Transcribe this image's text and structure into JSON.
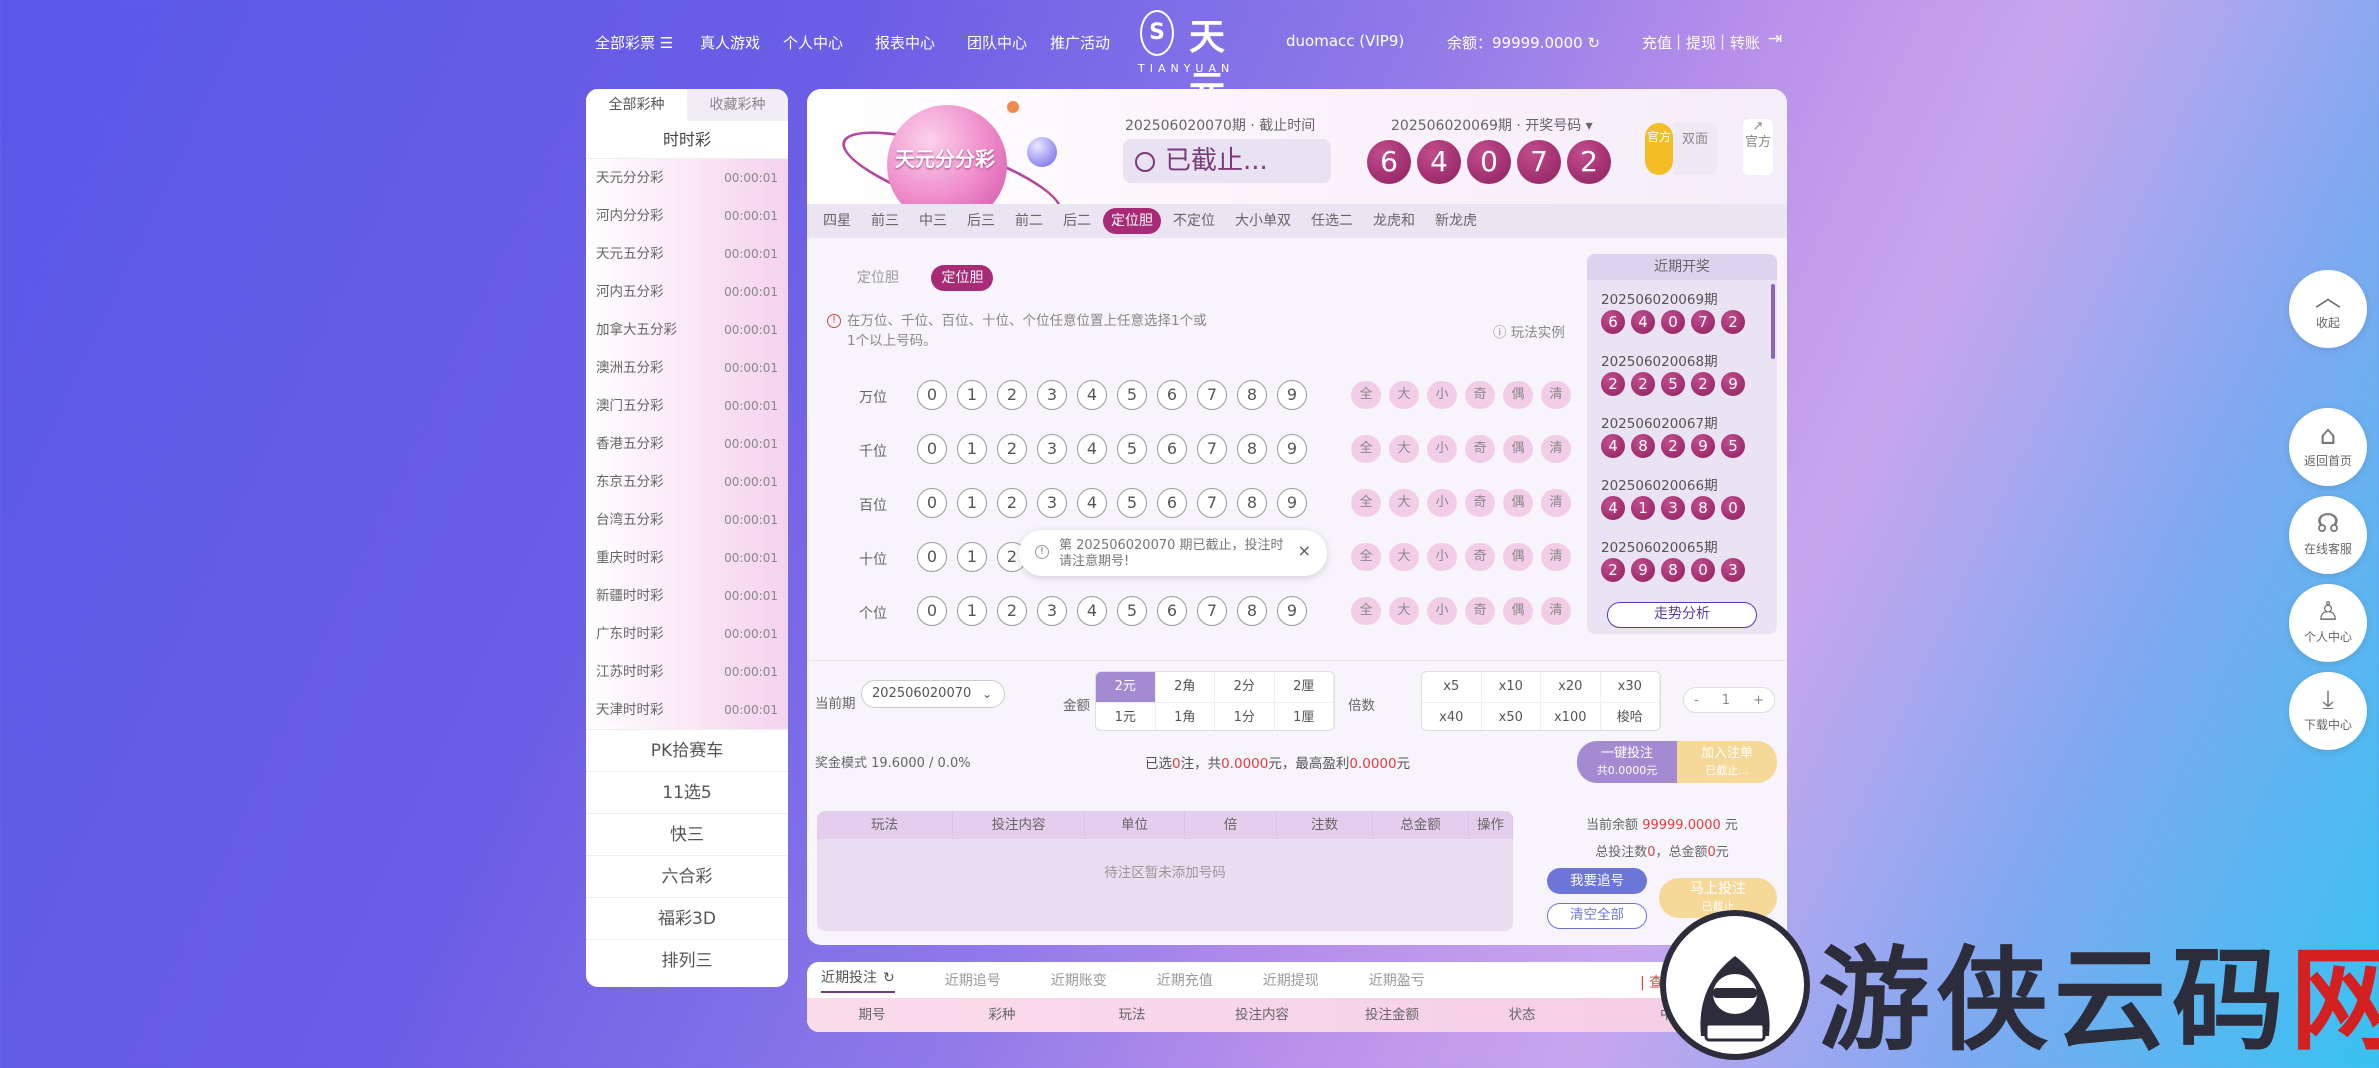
{
  "nav": {
    "all_lottery": "全部彩票",
    "live_games": "真人游戏",
    "personal_center": "个人中心",
    "reports": "报表中心",
    "team_center": "团队中心",
    "promotions": "推广活动",
    "username": "duomacc (VIP9)",
    "balance_label": "余额：99999.0000",
    "recharge": "充值",
    "withdraw": "提现",
    "transfer": "转账",
    "sep": "|"
  },
  "logo": {
    "seal": "S",
    "cn": "天元",
    "en": "TIANYUAN"
  },
  "sidebar": {
    "tabs": [
      "全部彩种",
      "收藏彩种"
    ],
    "group_title": "时时彩",
    "items": [
      {
        "name": "天元分分彩",
        "time": "00:00:01"
      },
      {
        "name": "河内分分彩",
        "time": "00:00:01"
      },
      {
        "name": "天元五分彩",
        "time": "00:00:01"
      },
      {
        "name": "河内五分彩",
        "time": "00:00:01"
      },
      {
        "name": "加拿大五分彩",
        "time": "00:00:01"
      },
      {
        "name": "澳洲五分彩",
        "time": "00:00:01"
      },
      {
        "name": "澳门五分彩",
        "time": "00:00:01"
      },
      {
        "name": "香港五分彩",
        "time": "00:00:01"
      },
      {
        "name": "东京五分彩",
        "time": "00:00:01"
      },
      {
        "name": "台湾五分彩",
        "time": "00:00:01"
      },
      {
        "name": "重庆时时彩",
        "time": "00:00:01"
      },
      {
        "name": "新疆时时彩",
        "time": "00:00:01"
      },
      {
        "name": "广东时时彩",
        "time": "00:00:01"
      },
      {
        "name": "江苏时时彩",
        "time": "00:00:01"
      },
      {
        "name": "天津时时彩",
        "time": "00:00:01"
      }
    ],
    "categories": [
      "PK拾赛车",
      "11选5",
      "快三",
      "六合彩",
      "福彩3D",
      "排列三"
    ]
  },
  "banner": {
    "lottery_name": "天元分分彩",
    "current_period_label": "202506020070期 · 截止时间",
    "closed_text": "已截止...",
    "open_period_label": "202506020069期 · 开奖号码 ▾",
    "open_numbers": [
      "6",
      "4",
      "0",
      "7",
      "2"
    ],
    "official_badge": "官方",
    "double_side": "双面",
    "official_link": "官方"
  },
  "play_tabs": [
    "四星",
    "前三",
    "中三",
    "后三",
    "前二",
    "后二",
    "定位胆",
    "不定位",
    "大小单双",
    "任选二",
    "龙虎和",
    "新龙虎"
  ],
  "play_tab_active": "定位胆",
  "sub_tabs": [
    "定位胆",
    "定位胆"
  ],
  "hint": {
    "text": "在万位、千位、百位、十位、个位任意位置上任意选择1个或1个以上号码。",
    "example": "玩法实例"
  },
  "positions": [
    "万位",
    "千位",
    "百位",
    "十位",
    "个位"
  ],
  "digits": [
    "0",
    "1",
    "2",
    "3",
    "4",
    "5",
    "6",
    "7",
    "8",
    "9"
  ],
  "quick": [
    "全",
    "大",
    "小",
    "奇",
    "偶",
    "清"
  ],
  "recent": {
    "title": "近期开奖",
    "draws": [
      {
        "period": "202506020069期",
        "nums": [
          "6",
          "4",
          "0",
          "7",
          "2"
        ]
      },
      {
        "period": "202506020068期",
        "nums": [
          "2",
          "2",
          "5",
          "2",
          "9"
        ]
      },
      {
        "period": "202506020067期",
        "nums": [
          "4",
          "8",
          "2",
          "9",
          "5"
        ]
      },
      {
        "period": "202506020066期",
        "nums": [
          "4",
          "1",
          "3",
          "8",
          "0"
        ]
      },
      {
        "period": "202506020065期",
        "nums": [
          "2",
          "9",
          "8",
          "0",
          "3"
        ]
      }
    ],
    "trend_button": "走势分析"
  },
  "toast": {
    "text": "第 202506020070 期已截止，投注时请注意期号!",
    "close": "×"
  },
  "bet": {
    "current_period_label": "当前期",
    "current_period_value": "202506020070",
    "amount_label": "金额",
    "amounts": [
      "2元",
      "2角",
      "2分",
      "2厘",
      "1元",
      "1角",
      "1分",
      "1厘"
    ],
    "multiple_label": "倍数",
    "multiples": [
      "x5",
      "x10",
      "x20",
      "x30",
      "x40",
      "x50",
      "x100",
      "梭哈"
    ],
    "stepper_minus": "-",
    "stepper_value": "1",
    "stepper_plus": "+",
    "mode_text": "奖金模式 19.6000 / 0.0%",
    "selected_a": "已选",
    "selected_count": "0",
    "selected_b": "注，共",
    "selected_total": "0.0000",
    "selected_c": "元，最高盈利",
    "selected_profit": "0.0000",
    "selected_d": "元",
    "one_key_bet": "一键投注",
    "one_key_sub": "共0.0000元",
    "add_order": "加入注单",
    "add_order_sub": "已截止..."
  },
  "order_table": {
    "headers": [
      "玩法",
      "投注内容",
      "单位",
      "倍",
      "注数",
      "总金额",
      "操作"
    ],
    "empty": "待注区暂未添加号码"
  },
  "summary": {
    "balance_prefix": "当前余额",
    "balance_value": "99999.0000",
    "balance_suffix": "元",
    "total_a": "总投注数",
    "total_count": "0",
    "total_b": "，总金额",
    "total_amount": "0",
    "total_c": "元",
    "follow": "我要追号",
    "clear_all": "清空全部",
    "bet_now": "马上投注",
    "bet_now_sub": "已截止"
  },
  "bottom": {
    "tabs": [
      "近期投注",
      "近期追号",
      "近期账变",
      "近期充值",
      "近期提现",
      "近期盈亏"
    ],
    "view_all": "查看全部",
    "headers": [
      "期号",
      "彩种",
      "玩法",
      "投注内容",
      "投注金额",
      "状态",
      "中奖金额"
    ]
  },
  "floats": [
    "收起",
    "返回首页",
    "在线客服",
    "个人中心",
    "下载中心"
  ],
  "watermark": {
    "text_a": "游侠云码",
    "text_b": "网"
  }
}
